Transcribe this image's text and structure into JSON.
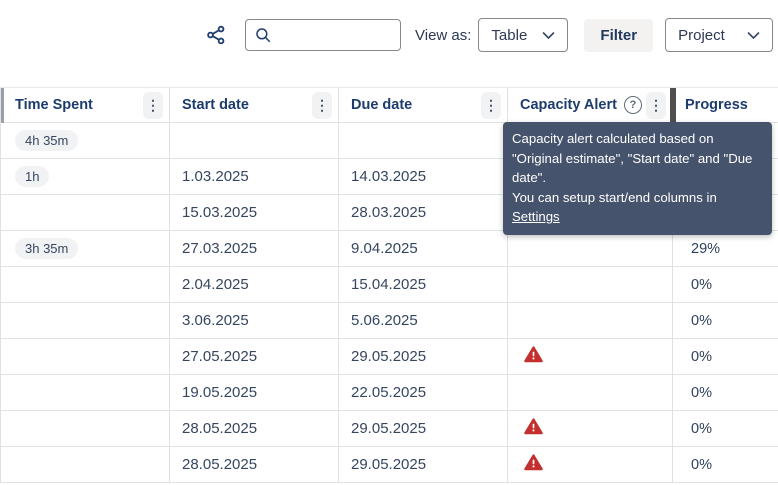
{
  "toolbar": {
    "view_as_label": "View as:",
    "view_select": {
      "value": "Table"
    },
    "filter_label": "Filter",
    "project_select": {
      "value": "Project"
    },
    "search": {
      "value": "",
      "placeholder": ""
    },
    "icons": [
      "share-icon",
      "search-icon",
      "chevron-down-icon"
    ]
  },
  "table": {
    "columns": [
      {
        "label": "Time Spent"
      },
      {
        "label": "Start date"
      },
      {
        "label": "Due date"
      },
      {
        "label": "Capacity Alert"
      },
      {
        "label": "Progress"
      }
    ],
    "rows": [
      {
        "time_spent": "4h 35m",
        "start": "",
        "due": "",
        "alert": false,
        "progress": ""
      },
      {
        "time_spent": "1h",
        "start": "1.03.2025",
        "due": "14.03.2025",
        "alert": false,
        "progress": ""
      },
      {
        "time_spent": "",
        "start": "15.03.2025",
        "due": "28.03.2025",
        "alert": false,
        "progress": ""
      },
      {
        "time_spent": "3h 35m",
        "start": "27.03.2025",
        "due": "9.04.2025",
        "alert": false,
        "progress": "29%"
      },
      {
        "time_spent": "",
        "start": "2.04.2025",
        "due": "15.04.2025",
        "alert": false,
        "progress": "0%"
      },
      {
        "time_spent": "",
        "start": "3.06.2025",
        "due": "5.06.2025",
        "alert": false,
        "progress": "0%"
      },
      {
        "time_spent": "",
        "start": "27.05.2025",
        "due": "29.05.2025",
        "alert": true,
        "progress": "0%"
      },
      {
        "time_spent": "",
        "start": "19.05.2025",
        "due": "22.05.2025",
        "alert": false,
        "progress": "0%"
      },
      {
        "time_spent": "",
        "start": "28.05.2025",
        "due": "29.05.2025",
        "alert": true,
        "progress": "0%"
      },
      {
        "time_spent": "",
        "start": "28.05.2025",
        "due": "29.05.2025",
        "alert": true,
        "progress": "0%"
      }
    ]
  },
  "tooltip": {
    "line1": "Capacity alert calculated based on \"Original estimate\", \"Start date\" and \"Due date\".",
    "line2": "You can setup start/end columns in",
    "link_label": "Settings"
  },
  "colors": {
    "header_text": "#1d3c6e",
    "body_text": "#36465f",
    "alert_red": "#c62f2f",
    "tooltip_bg": "#46536c",
    "pill_bg": "#f1f2f4",
    "resize_bar_dark": "#4f4f4f"
  }
}
